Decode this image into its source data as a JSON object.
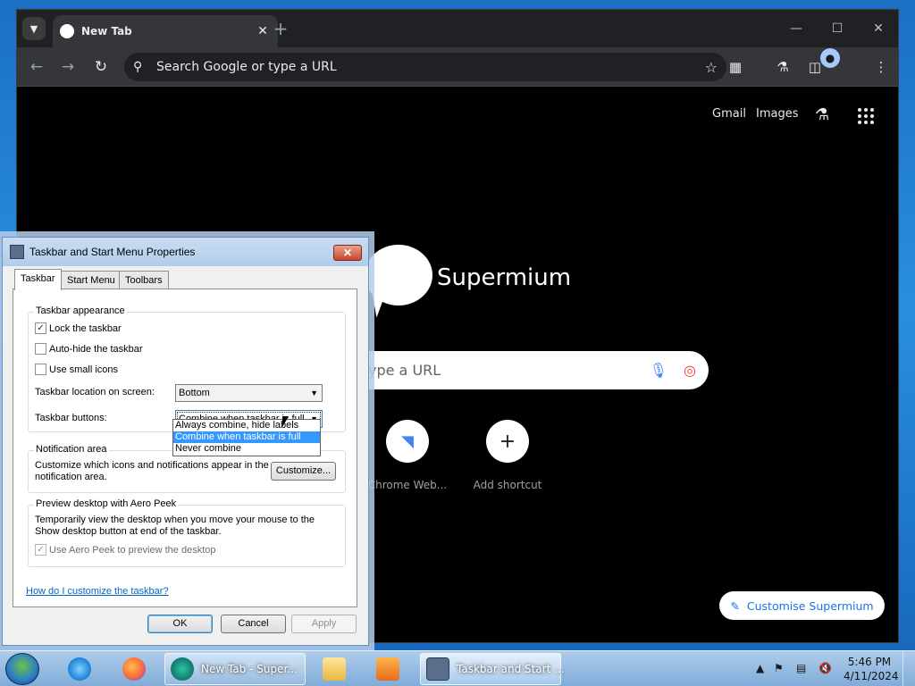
{
  "browser": {
    "tab_title": "New Tab",
    "omnibox_placeholder": "Search Google or type a URL",
    "header_links": [
      "Gmail",
      "Images"
    ],
    "logo_text": "Supermium",
    "search_placeholder_visible": "ype a URL",
    "shortcuts": [
      {
        "label": "Chrome Web...",
        "icon": "chrome-web-store-icon"
      },
      {
        "label": "Add shortcut",
        "icon": "plus-icon"
      }
    ],
    "customise_label": "Customise Supermium"
  },
  "dialog": {
    "title": "Taskbar and Start Menu Properties",
    "tabs": [
      "Taskbar",
      "Start Menu",
      "Toolbars"
    ],
    "active_tab": "Taskbar",
    "appearance": {
      "group_label": "Taskbar appearance",
      "lock_label": "Lock the taskbar",
      "lock_checked": true,
      "autohide_label": "Auto-hide the taskbar",
      "autohide_checked": false,
      "small_icons_label": "Use small icons",
      "small_icons_checked": false,
      "location_label": "Taskbar location on screen:",
      "location_value": "Bottom",
      "buttons_label": "Taskbar buttons:",
      "buttons_value": "Combine when taskbar is full",
      "buttons_options": [
        "Always combine, hide labels",
        "Combine when taskbar is full",
        "Never combine"
      ],
      "buttons_selected_index": 1
    },
    "notification": {
      "group_label": "Notification area",
      "description": "Customize which icons and notifications appear in the notification area.",
      "customize_button": "Customize..."
    },
    "aero_peek": {
      "group_label": "Preview desktop with Aero Peek",
      "description": "Temporarily view the desktop when you move your mouse to the Show desktop button at end of the taskbar.",
      "checkbox_label": "Use Aero Peek to preview the desktop",
      "checkbox_checked": true,
      "checkbox_enabled": false
    },
    "help_link": "How do I customize the taskbar?",
    "ok_label": "OK",
    "cancel_label": "Cancel",
    "apply_label": "Apply"
  },
  "taskbar": {
    "running_apps": [
      {
        "label": "New Tab - Super...",
        "icon": "supermium-icon"
      },
      {
        "label": "Taskbar and Start ...",
        "icon": "taskbar-properties-icon",
        "active": true
      }
    ],
    "clock_time": "5:46 PM",
    "clock_date": "4/11/2024"
  }
}
